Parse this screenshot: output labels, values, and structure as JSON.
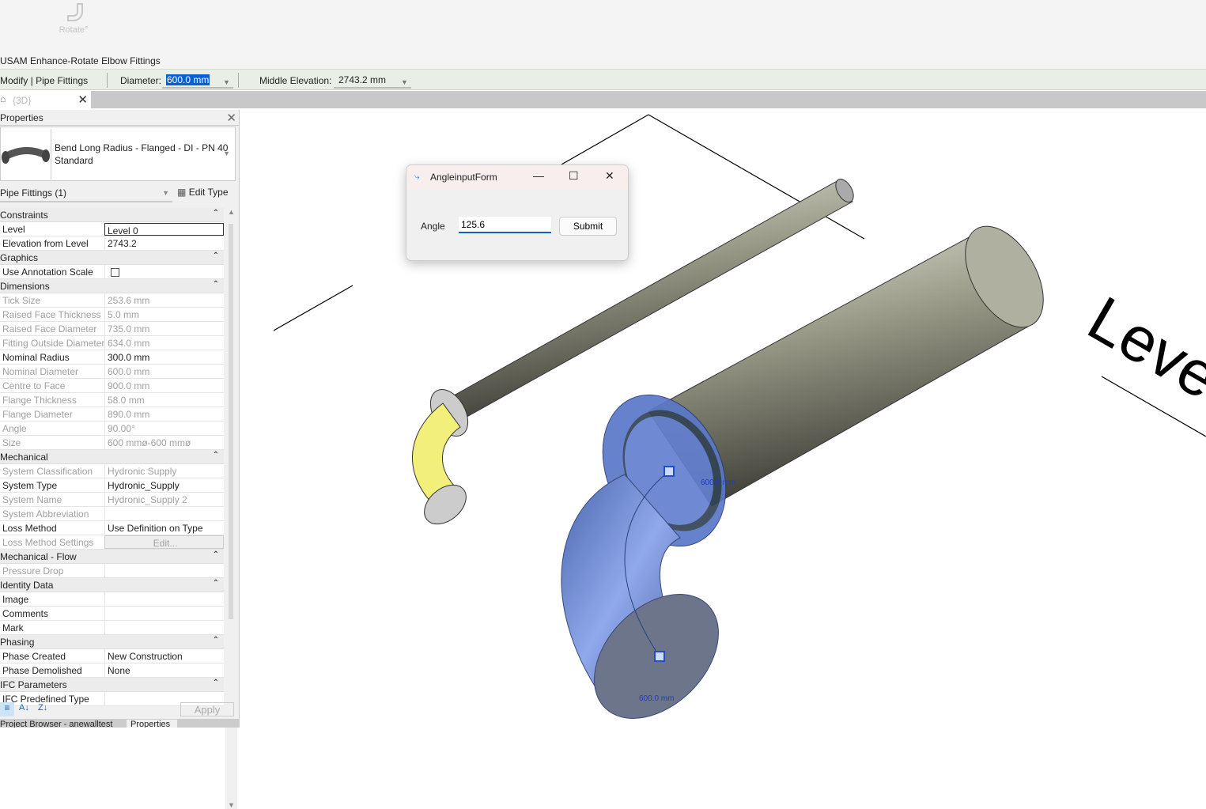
{
  "ribbon": {
    "rotate_label": "Rotate°",
    "panel_title": "USAM Enhance-Rotate Elbow Fittings"
  },
  "options_bar": {
    "context": "Modify | Pipe Fittings",
    "diameter_label": "Diameter:",
    "diameter_value": "600.0 mm",
    "middle_elevation_label": "Middle Elevation:",
    "middle_elevation_value": "2743.2 mm"
  },
  "view_tab": {
    "label": "{3D}"
  },
  "properties": {
    "title": "Properties",
    "type_name": "Bend Long Radius - Flanged - DI - PN 40",
    "type_sub": "Standard",
    "filter": "Pipe Fittings (1)",
    "edit_type": "Edit Type",
    "rows": [
      {
        "cat": "Constraints"
      },
      {
        "k": "Level",
        "v": "Level 0",
        "edit": true
      },
      {
        "k": "Elevation from Level",
        "v": "2743.2"
      },
      {
        "cat": "Graphics"
      },
      {
        "k": "Use Annotation Scale",
        "v": "",
        "check": true
      },
      {
        "cat": "Dimensions"
      },
      {
        "k": "Tick Size",
        "v": "253.6 mm",
        "ro": true
      },
      {
        "k": "Raised Face Thickness",
        "v": "5.0 mm",
        "ro": true
      },
      {
        "k": "Raised Face Diameter",
        "v": "735.0 mm",
        "ro": true
      },
      {
        "k": "Fitting Outside Diameter",
        "v": "634.0 mm",
        "ro": true
      },
      {
        "k": "Nominal Radius",
        "v": "300.0 mm"
      },
      {
        "k": "Nominal Diameter",
        "v": "600.0 mm",
        "ro": true
      },
      {
        "k": "Centre to Face",
        "v": "900.0 mm",
        "ro": true
      },
      {
        "k": "Flange Thickness",
        "v": "58.0 mm",
        "ro": true
      },
      {
        "k": "Flange Diameter",
        "v": "890.0 mm",
        "ro": true
      },
      {
        "k": "Angle",
        "v": "90.00°",
        "ro": true
      },
      {
        "k": "Size",
        "v": "600 mmø-600 mmø",
        "ro": true
      },
      {
        "cat": "Mechanical"
      },
      {
        "k": "System Classification",
        "v": "Hydronic Supply",
        "ro": true
      },
      {
        "k": "System Type",
        "v": "Hydronic_Supply"
      },
      {
        "k": "System Name",
        "v": "Hydronic_Supply 2",
        "ro": true
      },
      {
        "k": "System Abbreviation",
        "v": "",
        "ro": true
      },
      {
        "k": "Loss Method",
        "v": "Use Definition on Type"
      },
      {
        "k": "Loss Method Settings",
        "v": "Edit...",
        "ro": true,
        "btn": true
      },
      {
        "cat": "Mechanical - Flow"
      },
      {
        "k": "Pressure Drop",
        "v": "",
        "ro": true
      },
      {
        "cat": "Identity Data"
      },
      {
        "k": "Image",
        "v": ""
      },
      {
        "k": "Comments",
        "v": ""
      },
      {
        "k": "Mark",
        "v": ""
      },
      {
        "cat": "Phasing"
      },
      {
        "k": "Phase Created",
        "v": "New Construction"
      },
      {
        "k": "Phase Demolished",
        "v": "None"
      },
      {
        "cat": "IFC Parameters"
      },
      {
        "k": "IFC Predefined Type",
        "v": ""
      }
    ],
    "apply": "Apply",
    "bottom_tabs": [
      "Project Browser - anewalltest",
      "Properties"
    ]
  },
  "dialog": {
    "title": "AngleinputForm",
    "angle_label": "Angle",
    "angle_value": "125.6",
    "submit": "Submit"
  },
  "view": {
    "dim1": "600.0 mm",
    "dim2": "600.0 mm",
    "level_text": "Level"
  },
  "colors": {
    "selection": "#0a5fd0",
    "pipe": "#8c8c78",
    "selected_elbow": "#7b96e0",
    "highlight": "#f4f070"
  }
}
